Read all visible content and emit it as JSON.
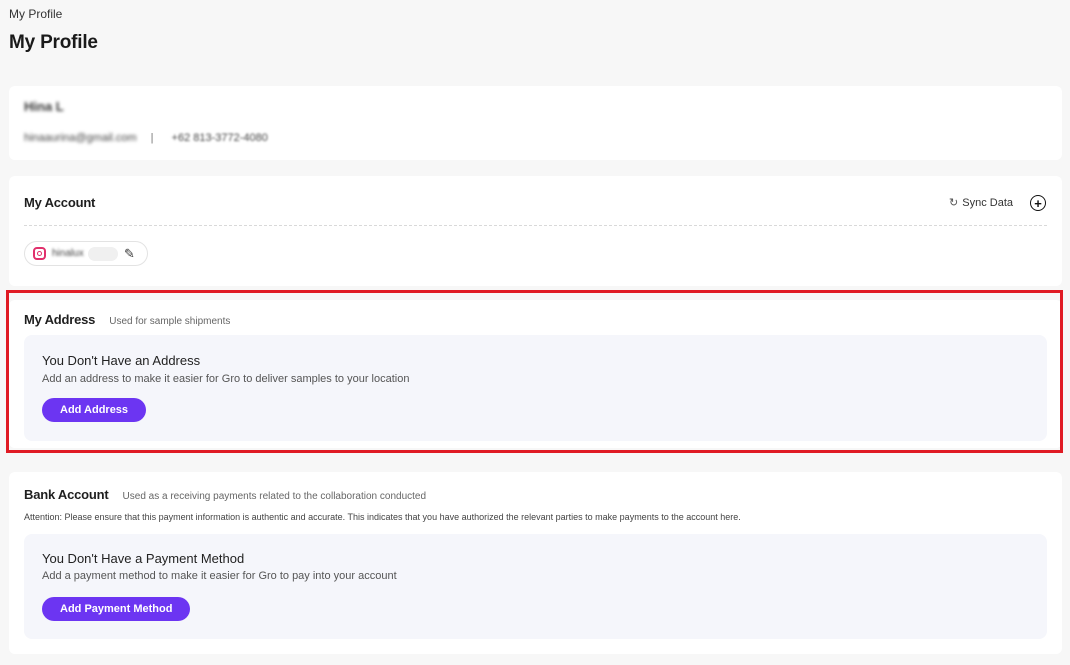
{
  "breadcrumb": "My Profile",
  "page_title": "My Profile",
  "profile": {
    "name": "Hina L",
    "email": "hinaaurina@gmail.com",
    "separator": "|",
    "phone": "+62 813-3772-4080"
  },
  "account": {
    "title": "My Account",
    "sync_label": "Sync Data",
    "sync_icon": "↻",
    "add_icon": "+",
    "edit_icon": "✎",
    "chip_handle": "hinalux"
  },
  "address": {
    "title": "My Address",
    "hint": "Used for sample shipments",
    "empty_title": "You Don't Have an Address",
    "empty_desc": "Add an address to make it easier for Gro to deliver samples to your location",
    "button": "Add Address"
  },
  "bank": {
    "title": "Bank Account",
    "hint": "Used as a receiving payments related to the collaboration conducted",
    "attention": "Attention: Please ensure that this payment information is authentic and accurate. This indicates that you have authorized the relevant parties to make payments to the account here.",
    "empty_title": "You Don't Have a Payment Method",
    "empty_desc": "Add a payment method to make it easier for Gro to pay into your account",
    "button": "Add Payment Method"
  },
  "colors": {
    "accent": "#6c35f2",
    "highlight": "#e01b24",
    "empty_bg": "#f5f6fb"
  }
}
